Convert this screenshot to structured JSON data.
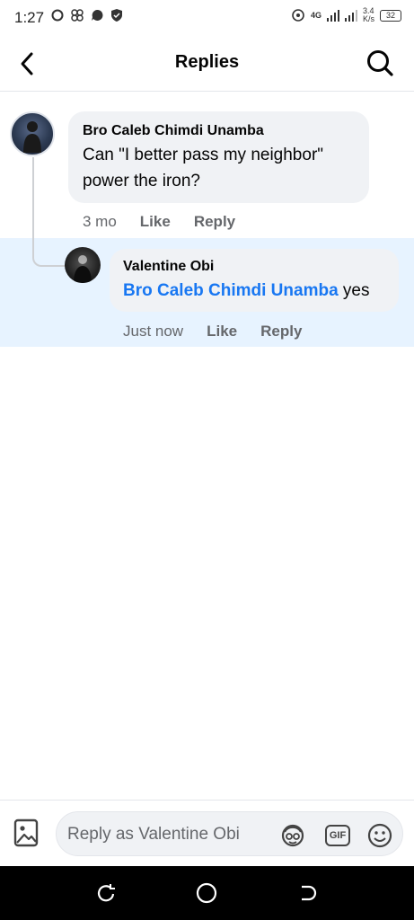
{
  "status": {
    "time": "1:27",
    "network": "4G",
    "speed_value": "3.4",
    "speed_unit": "K/s",
    "battery": "32"
  },
  "header": {
    "title": "Replies",
    "back_icon": "chevron-left-icon",
    "search_icon": "search-icon"
  },
  "comment": {
    "author": "Bro Caleb Chimdi Unamba",
    "text_line1": "Can \"I better pass my neighbor\"",
    "text_line2": "power the iron?",
    "time": "3 mo",
    "like_label": "Like",
    "reply_label": "Reply"
  },
  "reply": {
    "author": "Valentine Obi",
    "mention": "Bro Caleb Chimdi Unamba",
    "text": " yes",
    "time": "Just now",
    "like_label": "Like",
    "reply_label": "Reply"
  },
  "composer": {
    "placeholder": "Reply as Valentine Obi",
    "icons": [
      "photo-icon",
      "avatar-sticker-icon",
      "gif-icon",
      "emoji-icon"
    ],
    "gif_label": "GIF"
  },
  "colors": {
    "accent": "#1877f2",
    "bubble": "#f0f2f5",
    "highlight": "#e7f3ff",
    "muted": "#65676b"
  }
}
